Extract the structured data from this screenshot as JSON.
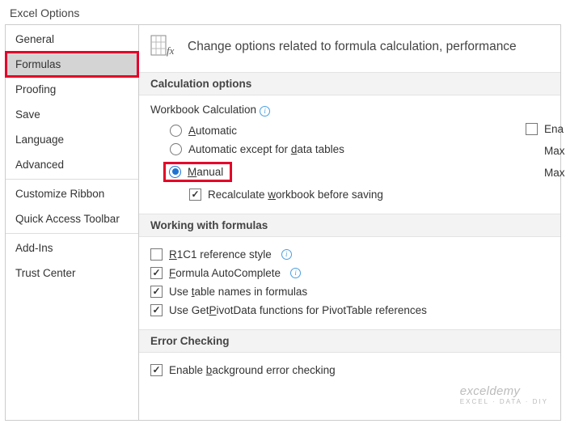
{
  "window": {
    "title": "Excel Options"
  },
  "sidebar": {
    "items": [
      {
        "label": "General"
      },
      {
        "label": "Formulas"
      },
      {
        "label": "Proofing"
      },
      {
        "label": "Save"
      },
      {
        "label": "Language"
      },
      {
        "label": "Advanced"
      },
      {
        "label": "Customize Ribbon"
      },
      {
        "label": "Quick Access Toolbar"
      },
      {
        "label": "Add-Ins"
      },
      {
        "label": "Trust Center"
      }
    ]
  },
  "header": {
    "text": "Change options related to formula calculation, performance"
  },
  "sections": {
    "calc": {
      "title": "Calculation options",
      "group_label": "Workbook Calculation",
      "opts": {
        "auto": "Automatic",
        "auto_except": "Automatic except for data tables",
        "manual": "Manual",
        "recalc": "Recalculate workbook before saving"
      },
      "right": {
        "enable": "Ena",
        "maxi": "Max",
        "maxc": "Max"
      }
    },
    "working": {
      "title": "Working with formulas",
      "opts": {
        "r1c1": "R1C1 reference style",
        "autocomplete": "Formula AutoComplete",
        "tablenames": "Use table names in formulas",
        "getpivot": "Use GetPivotData functions for PivotTable references"
      }
    },
    "error": {
      "title": "Error Checking",
      "opts": {
        "bg": "Enable background error checking"
      }
    }
  },
  "watermark": {
    "main": "exceldemy",
    "sub": "EXCEL · DATA · DIY"
  }
}
